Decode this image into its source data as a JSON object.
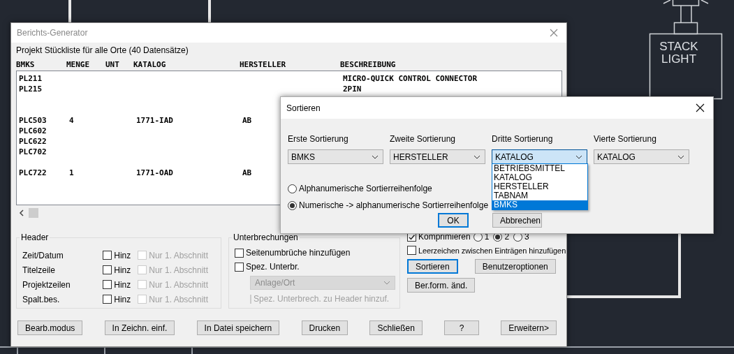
{
  "canvas": {
    "label": "STACK LIGHT"
  },
  "report_dialog": {
    "title": "Berichts-Generator",
    "caption": "Projekt Stückliste für alle Orte (40 Datensätze)",
    "columns": [
      "BMKS",
      "MENGE",
      "UNT",
      "KATALOG",
      "HERSTELLER",
      "BESCHREIBUNG"
    ],
    "rows": [
      {
        "kind": "entry",
        "cells": [
          "PL211",
          "",
          "",
          "",
          "",
          "MICRO-QUICK CONTROL CONNECTOR"
        ]
      },
      {
        "kind": "entry",
        "cells": [
          "PL215",
          "",
          "",
          "",
          "",
          "2PIN"
        ]
      },
      {
        "kind": "blank"
      },
      {
        "kind": "blank"
      },
      {
        "kind": "entry",
        "cells": [
          "PLC503",
          "4",
          "",
          "1771-IAD",
          "AB",
          ""
        ]
      },
      {
        "kind": "entry",
        "cells": [
          "PLC602",
          "",
          "",
          "",
          "",
          ""
        ]
      },
      {
        "kind": "entry",
        "cells": [
          "PLC622",
          "",
          "",
          "",
          "",
          ""
        ]
      },
      {
        "kind": "entry",
        "cells": [
          "PLC702",
          "",
          "",
          "",
          "",
          ""
        ]
      },
      {
        "kind": "blank"
      },
      {
        "kind": "entry",
        "cells": [
          "PLC722",
          "1",
          "",
          "1771-OAD",
          "AB",
          ""
        ]
      }
    ],
    "header_group": {
      "title": "Header",
      "rows": [
        {
          "label": "Zeit/Datum",
          "add": {
            "label": "Hinz",
            "checked": false
          },
          "first_only": {
            "label": "Nur 1. Abschnitt",
            "checked": false,
            "disabled": true
          }
        },
        {
          "label": "Titelzeile",
          "add": {
            "label": "Hinz",
            "checked": false
          },
          "first_only": {
            "label": "Nur 1. Abschnitt",
            "checked": false,
            "disabled": true
          }
        },
        {
          "label": "Projektzeilen",
          "add": {
            "label": "Hinz",
            "checked": false
          },
          "first_only": {
            "label": "Nur 1. Abschnitt",
            "checked": false,
            "disabled": true
          }
        },
        {
          "label": "Spalt.bes.",
          "add": {
            "label": "Hinz",
            "checked": false
          },
          "first_only": {
            "label": "Nur 1. Abschnitt",
            "checked": false,
            "disabled": true
          }
        }
      ]
    },
    "breaks_group": {
      "title": "Unterbrechungen",
      "page_breaks": {
        "label": "Seitenumbrüche hinzufügen",
        "checked": false,
        "disabled": false
      },
      "special_breaks": {
        "label": "Spez. Unterbr.",
        "checked": false,
        "disabled": false
      },
      "break_select": {
        "value": "Anlage/Ort",
        "disabled": true
      },
      "break_to_header": {
        "label": "Spez. Unterbrech. zu Header hinzuf.",
        "checked": false,
        "disabled": true
      }
    },
    "compress": {
      "label": "Komprimieren",
      "checked": true,
      "options": [
        {
          "label": "1",
          "selected": false
        },
        {
          "label": "2",
          "selected": true
        },
        {
          "label": "3",
          "selected": false
        }
      ]
    },
    "spaces": {
      "label": "Leerzeichen zwischen Einträgen hinzufügen",
      "checked": false
    },
    "option_buttons": [
      {
        "label": "Sortieren",
        "focused": true
      },
      {
        "label": "Benutzeroptionen",
        "focused": false
      },
      {
        "label": "Ber.form. änd.",
        "focused": false
      }
    ],
    "buttons": [
      "Bearb.modus",
      "In Zeichn. einf.",
      "In Datei speichern",
      "Drucken",
      "Schließen",
      "?",
      "Erweitern>"
    ]
  },
  "sort_dialog": {
    "title": "Sortieren",
    "sorts": [
      {
        "label": "Erste Sortierung",
        "value": "BMKS",
        "open": false
      },
      {
        "label": "Zweite Sortierung",
        "value": "HERSTELLER",
        "open": false
      },
      {
        "label": "Dritte Sortierung",
        "value": "KATALOG",
        "open": true
      },
      {
        "label": "Vierte Sortierung",
        "value": "KATALOG",
        "open": false
      }
    ],
    "dropdown_options": [
      {
        "label": "BETRIEBSMITTEL",
        "selected": false
      },
      {
        "label": "KATALOG",
        "selected": false
      },
      {
        "label": "HERSTELLER",
        "selected": false
      },
      {
        "label": "TABNAM",
        "selected": false
      },
      {
        "label": "BMKS",
        "selected": true
      }
    ],
    "order": [
      {
        "label": "Alphanumerische Sortierreihenfolge",
        "selected": false
      },
      {
        "label": "Numerische -> alphanumerische Sortierreihenfolge",
        "selected": true
      }
    ],
    "ok": "OK",
    "cancel": "Abbrechen"
  }
}
